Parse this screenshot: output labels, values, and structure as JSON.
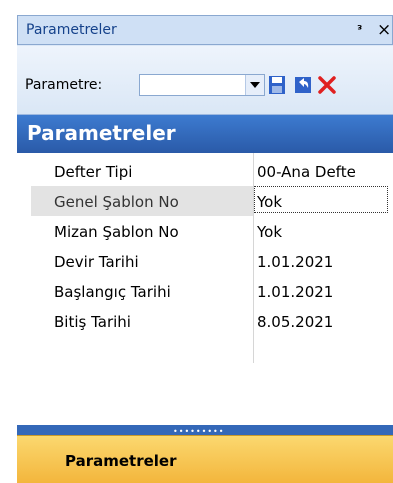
{
  "titlebar": {
    "title": "Parametreler",
    "pin_glyph": "Ѧ",
    "close_glyph": "×"
  },
  "toolbar": {
    "param_label": "Parametre:",
    "combo_value": "",
    "icons": [
      "dropdown-arrow-icon",
      "save-icon",
      "undo-icon",
      "delete-icon"
    ],
    "colors": {
      "save": "#2f62c9",
      "undo": "#2f62c9",
      "delete": "#e02020"
    }
  },
  "section": {
    "title": "Parametreler"
  },
  "grid": {
    "rows": [
      {
        "key": "Defter Tipi",
        "value": "00-Ana Defte"
      },
      {
        "key": "Genel Şablon No",
        "value": "Yok"
      },
      {
        "key": "Mizan Şablon No",
        "value": "Yok"
      },
      {
        "key": "Devir Tarihi",
        "value": "1.01.2021"
      },
      {
        "key": "Başlangıç Tarihi",
        "value": "1.01.2021"
      },
      {
        "key": "Bitiş Tarihi",
        "value": "8.05.2021"
      }
    ]
  },
  "footer": {
    "label": "Parametreler"
  },
  "colors": {
    "header": "#2f62b5",
    "footer": "#f6c24f"
  }
}
